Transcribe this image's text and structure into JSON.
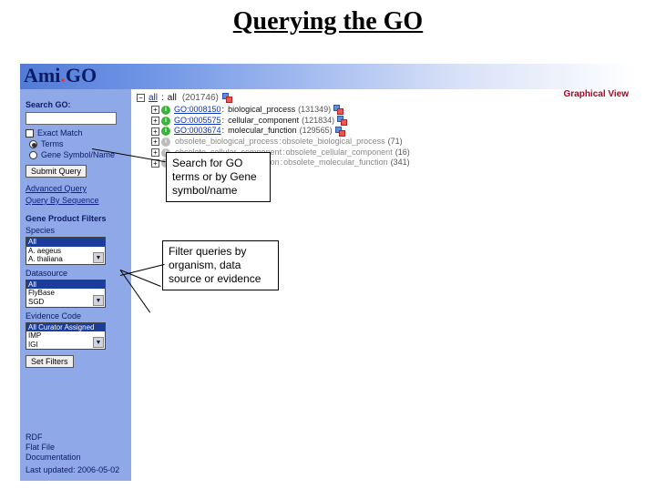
{
  "slide_title": "Querying the GO",
  "logo": {
    "prefix": "Ami",
    "dot": ".",
    "suffix": "GO"
  },
  "graphical_view": "Graphical View",
  "sidebar": {
    "search_heading": "Search GO:",
    "exact_match": "Exact Match",
    "radio_terms": "Terms",
    "radio_genes": "Gene Symbol/Name",
    "submit": "Submit Query",
    "advanced": "Advanced Query",
    "by_sequence": "Query By Sequence",
    "filters_heading": "Gene Product Filters",
    "species_label": "Species",
    "species_options": [
      "All",
      "A. aegeus",
      "A. thaliana"
    ],
    "datasource_label": "Datasource",
    "datasource_options": [
      "All",
      "FlyBase",
      "SGD"
    ],
    "evidence_label": "Evidence Code",
    "evidence_options": [
      "All Curator Assigned",
      "IMP",
      "IGI"
    ],
    "set_filters": "Set Filters",
    "footer_rdf": "RDF",
    "footer_flat": "Flat File",
    "footer_doc": "Documentation",
    "footer_updated": "Last updated: 2006-05-02"
  },
  "tree": {
    "root_label": "all",
    "root_count": "(201746)",
    "rows": [
      {
        "id": "GO:0008150",
        "name": "biological_process",
        "count": "(131349)"
      },
      {
        "id": "GO:0005575",
        "name": "cellular_component",
        "count": "(121834)"
      },
      {
        "id": "GO:0003674",
        "name": "molecular_function",
        "count": "(129565)"
      }
    ],
    "obs_rows": [
      {
        "name": "obsolete_biological_process",
        "count": "(71)"
      },
      {
        "name": "obsolete_cellular_component",
        "count": "(16)"
      },
      {
        "name": "obsolete_molecular_function",
        "count": "(341)"
      }
    ]
  },
  "callouts": {
    "search": "Search for GO terms or by Gene symbol/name",
    "filter": "Filter queries by organism, data source or evidence"
  }
}
